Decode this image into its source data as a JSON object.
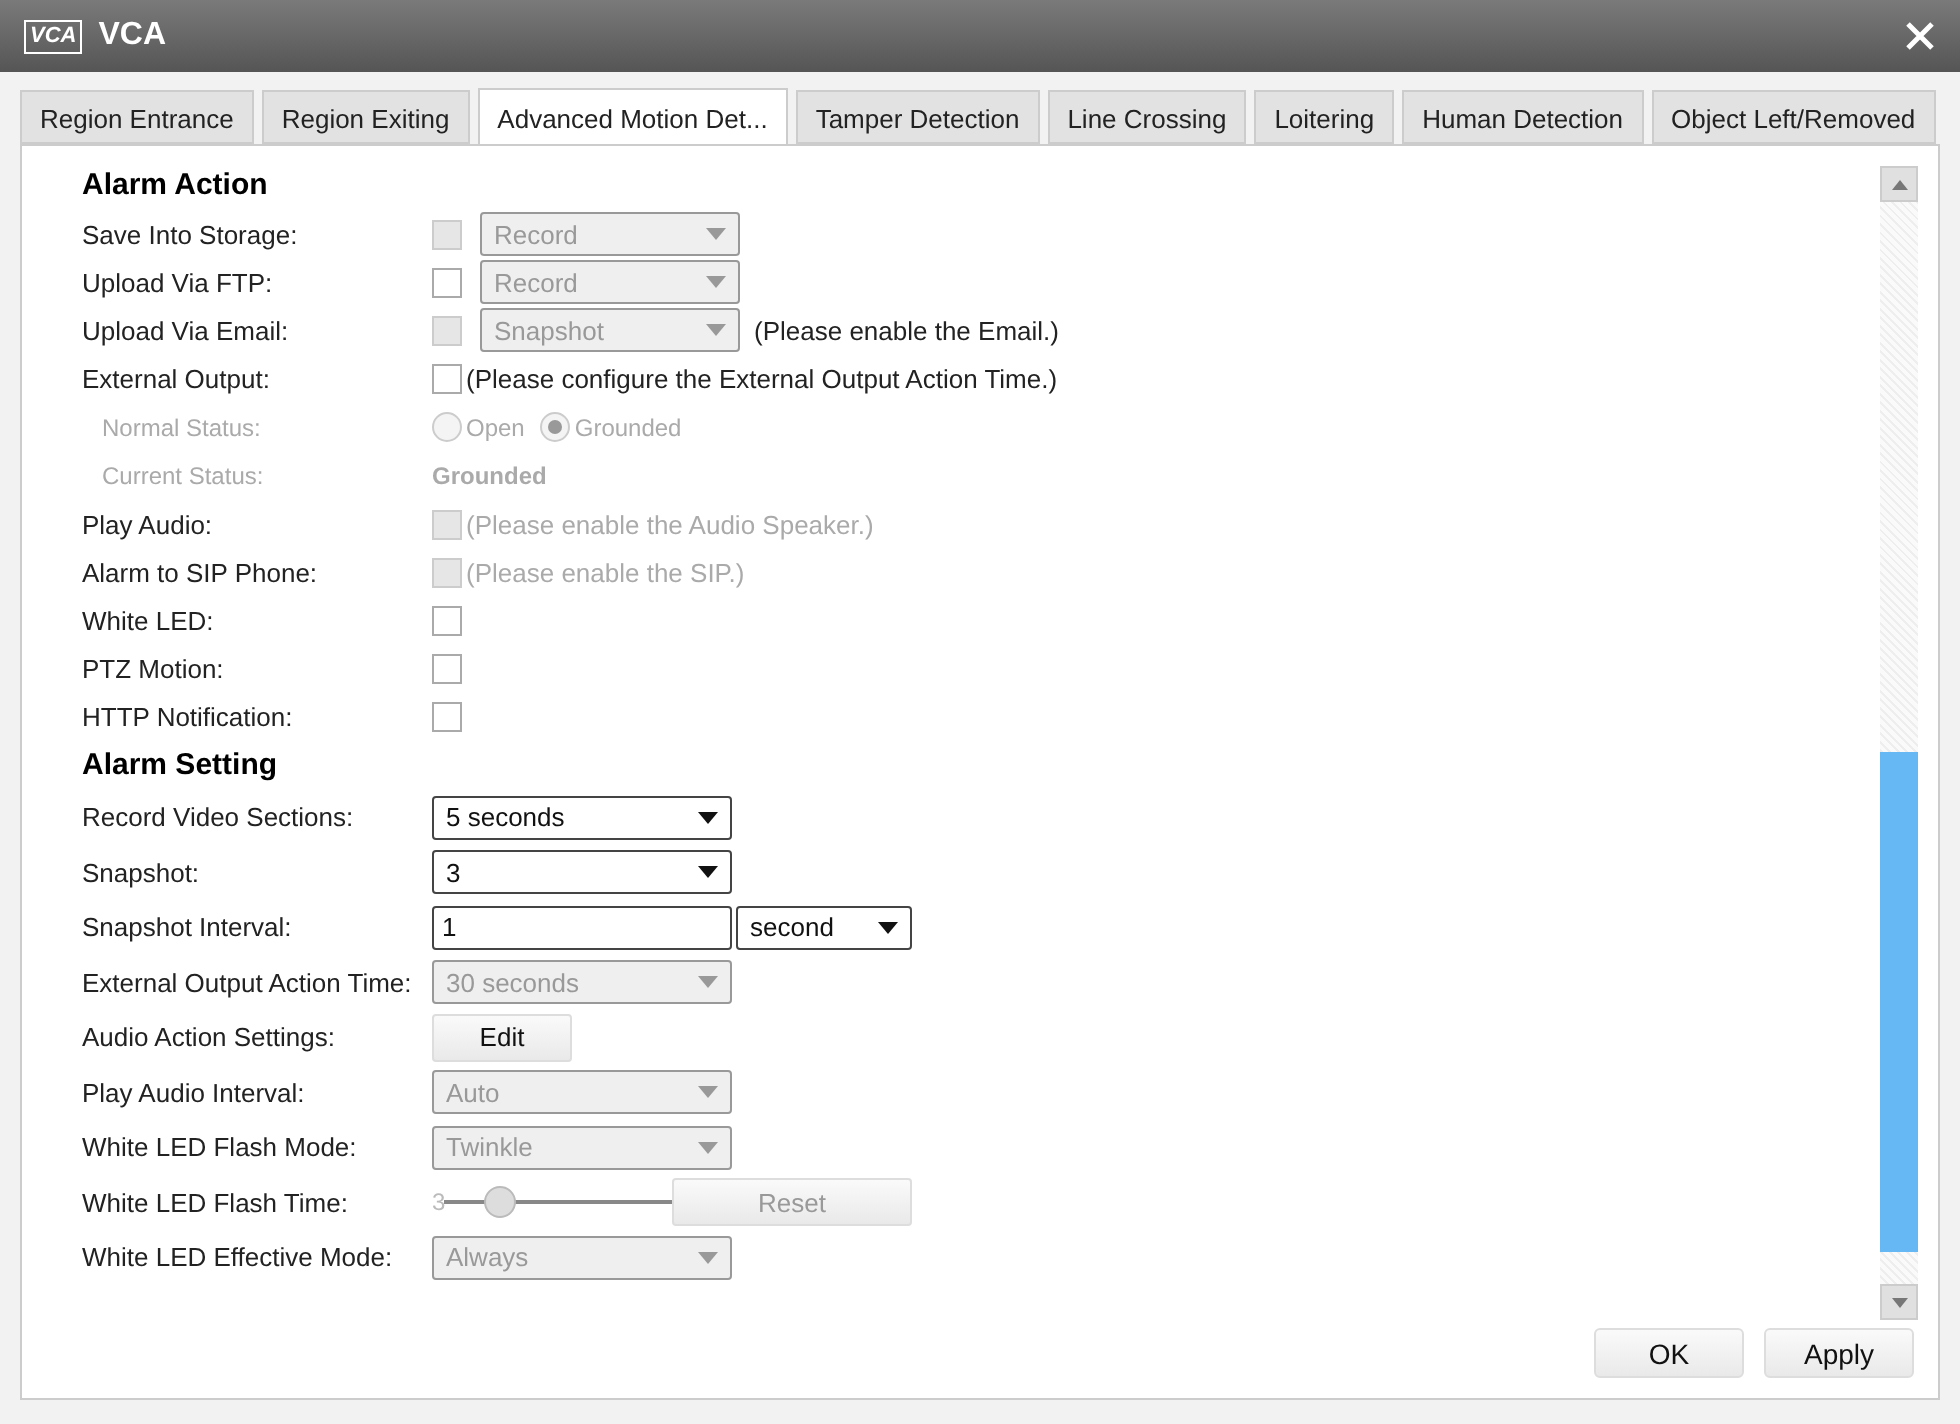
{
  "window": {
    "logo": "VCA",
    "title": "VCA"
  },
  "tabs": [
    {
      "label": "Region Entrance",
      "selected": false
    },
    {
      "label": "Region Exiting",
      "selected": false
    },
    {
      "label": "Advanced Motion Det...",
      "selected": true
    },
    {
      "label": "Tamper Detection",
      "selected": false
    },
    {
      "label": "Line Crossing",
      "selected": false
    },
    {
      "label": "Loitering",
      "selected": false
    },
    {
      "label": "Human Detection",
      "selected": false
    },
    {
      "label": "Object Left/Removed",
      "selected": false
    }
  ],
  "sections": [
    {
      "title": "Alarm Action",
      "rows": [
        {
          "kind": "check-select",
          "label": "Save Into Storage:",
          "checked": false,
          "check_disabled": true,
          "select": "Record",
          "select_disabled": true
        },
        {
          "kind": "check-select",
          "label": "Upload Via FTP:",
          "checked": false,
          "check_disabled": false,
          "select": "Record",
          "select_disabled": true
        },
        {
          "kind": "check-select",
          "label": "Upload Via Email:",
          "checked": false,
          "check_disabled": true,
          "select": "Snapshot",
          "select_disabled": true,
          "note": "(Please enable the Email.)"
        },
        {
          "kind": "check-note",
          "label": "External Output:",
          "checked": false,
          "check_disabled": false,
          "note": "(Please configure the External Output Action Time.)"
        },
        {
          "kind": "radio",
          "label": "Normal Status:",
          "disabled": true,
          "options": [
            {
              "label": "Open",
              "selected": false
            },
            {
              "label": "Grounded",
              "selected": true
            }
          ]
        },
        {
          "kind": "status",
          "label": "Current Status:",
          "disabled": true,
          "value": "Grounded"
        },
        {
          "kind": "check-note",
          "label": "Play Audio:",
          "checked": false,
          "check_disabled": true,
          "note": "(Please enable the Audio Speaker.)"
        },
        {
          "kind": "check-note",
          "label": "Alarm to SIP Phone:",
          "checked": false,
          "check_disabled": true,
          "note": "(Please enable the SIP.)"
        },
        {
          "kind": "check-note",
          "label": "White LED:",
          "checked": false,
          "check_disabled": false
        },
        {
          "kind": "check-note",
          "label": "PTZ Motion:",
          "checked": false,
          "check_disabled": false
        },
        {
          "kind": "check-note",
          "label": "HTTP Notification:",
          "checked": false,
          "check_disabled": false
        }
      ]
    },
    {
      "title": "Alarm Setting",
      "rows": [
        {
          "kind": "select",
          "label": "Record Video Sections:",
          "select": "5 seconds",
          "select_disabled": false
        },
        {
          "kind": "select",
          "label": "Snapshot:",
          "select": "3",
          "select_disabled": false
        },
        {
          "kind": "input-select",
          "label": "Snapshot Interval:",
          "value": "1",
          "select": "second",
          "select_disabled": false
        },
        {
          "kind": "select",
          "label": "External Output Action Time:",
          "select": "30 seconds",
          "select_disabled": true
        },
        {
          "kind": "button",
          "label": "Audio Action Settings:",
          "button": "Edit"
        },
        {
          "kind": "select",
          "label": "Play Audio Interval:",
          "select": "Auto",
          "select_disabled": true
        },
        {
          "kind": "select",
          "label": "White LED Flash Mode:",
          "select": "Twinkle",
          "select_disabled": true
        },
        {
          "kind": "slider",
          "label": "White LED Flash Time:",
          "reading": "3",
          "level": 0.2,
          "disabled": true,
          "button": "Reset"
        },
        {
          "kind": "select",
          "label": "White LED Effective Mode:",
          "select": "Always",
          "select_disabled": true
        }
      ]
    }
  ],
  "buttons": [
    "OK",
    "Apply"
  ]
}
